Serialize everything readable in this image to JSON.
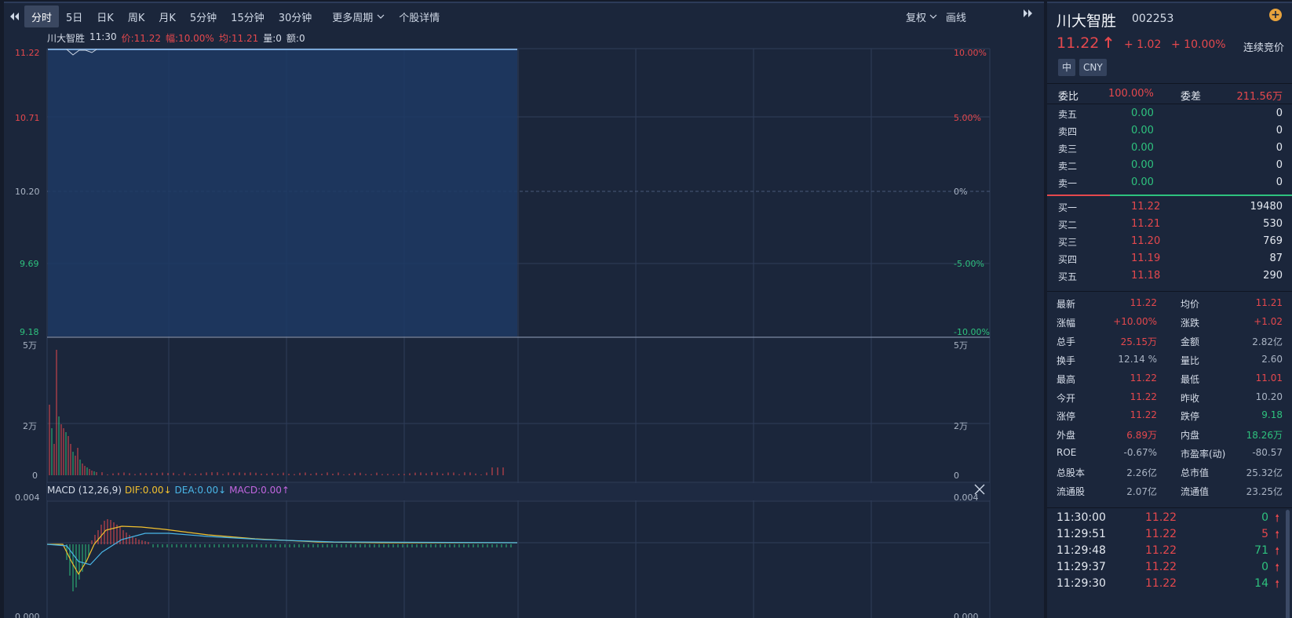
{
  "toolbar": {
    "tabs": [
      "分时",
      "5日",
      "日K",
      "周K",
      "月K",
      "5分钟",
      "15分钟",
      "30分钟",
      "更多周期",
      "个股详情"
    ],
    "right": [
      "复权",
      "画线"
    ]
  },
  "info": {
    "name": "川大智胜",
    "time": "11:30",
    "price": "价:11.22",
    "pct": "幅:10.00%",
    "avg": "均:11.21",
    "vol": "量:0",
    "amt": "额:0"
  },
  "axes": {
    "price_left": [
      "11.22",
      "10.71",
      "10.20",
      "9.69",
      "9.18"
    ],
    "price_right": [
      "10.00%",
      "5.00%",
      "0%",
      "-5.00%",
      "-10.00%"
    ],
    "vol_left": [
      "5万",
      "2万",
      "0"
    ],
    "vol_right": [
      "5万",
      "2万",
      "0"
    ],
    "macd_left": [
      "0.004",
      "0.000"
    ],
    "macd_right": [
      "0.004",
      "0.000"
    ]
  },
  "macd": {
    "label": "MACD (12,26,9)",
    "dif": "DIF:0.00↓",
    "dea": "DEA:0.00↓",
    "macd": "MACD:0.00↑"
  },
  "colors": {
    "up": "#e5484d",
    "down": "#2ec27e",
    "bg": "#1b263b",
    "dif": "#f2c12e",
    "dea": "#4ab7e8",
    "macd": "#c266e0"
  },
  "stock": {
    "name": "川大智胜",
    "code": "002253",
    "price": "11.22",
    "change": "+ 1.02",
    "pct": "+ 10.00%",
    "status": "连续竞价",
    "tags": [
      "中",
      "CNY"
    ],
    "weibi_label": "委比",
    "weibi": "100.00%",
    "weicha_label": "委差",
    "weicha": "211.56万"
  },
  "asks": [
    {
      "label": "卖五",
      "price": "0.00",
      "vol": "0"
    },
    {
      "label": "卖四",
      "price": "0.00",
      "vol": "0"
    },
    {
      "label": "卖三",
      "price": "0.00",
      "vol": "0"
    },
    {
      "label": "卖二",
      "price": "0.00",
      "vol": "0"
    },
    {
      "label": "卖一",
      "price": "0.00",
      "vol": "0"
    }
  ],
  "bids": [
    {
      "label": "买一",
      "price": "11.22",
      "vol": "19480"
    },
    {
      "label": "买二",
      "price": "11.21",
      "vol": "530"
    },
    {
      "label": "买三",
      "price": "11.20",
      "vol": "769"
    },
    {
      "label": "买四",
      "price": "11.19",
      "vol": "87"
    },
    {
      "label": "买五",
      "price": "11.18",
      "vol": "290"
    }
  ],
  "quotes": [
    {
      "l1": "最新",
      "v1": "11.22",
      "c1": "red",
      "l2": "均价",
      "v2": "11.21",
      "c2": "red"
    },
    {
      "l1": "涨幅",
      "v1": "+10.00%",
      "c1": "red",
      "l2": "涨跌",
      "v2": "+1.02",
      "c2": "red"
    },
    {
      "l1": "总手",
      "v1": "25.15万",
      "c1": "red",
      "l2": "金额",
      "v2": "2.82亿",
      "c2": "gray"
    },
    {
      "l1": "换手",
      "v1": "12.14 %",
      "c1": "gray",
      "l2": "量比",
      "v2": "2.60",
      "c2": "gray"
    },
    {
      "l1": "最高",
      "v1": "11.22",
      "c1": "red",
      "l2": "最低",
      "v2": "11.01",
      "c2": "red"
    },
    {
      "l1": "今开",
      "v1": "11.22",
      "c1": "red",
      "l2": "昨收",
      "v2": "10.20",
      "c2": "gray"
    },
    {
      "l1": "涨停",
      "v1": "11.22",
      "c1": "red",
      "l2": "跌停",
      "v2": "9.18",
      "c2": "green"
    },
    {
      "l1": "外盘",
      "v1": "6.89万",
      "c1": "red",
      "l2": "内盘",
      "v2": "18.26万",
      "c2": "green"
    },
    {
      "l1": "ROE",
      "v1": "-0.67%",
      "c1": "gray",
      "l2": "市盈率(动)",
      "v2": "-80.57",
      "c2": "gray"
    },
    {
      "l1": "总股本",
      "v1": "2.26亿",
      "c1": "gray",
      "l2": "总市值",
      "v2": "25.32亿",
      "c2": "gray"
    },
    {
      "l1": "流通股",
      "v1": "2.07亿",
      "c1": "gray",
      "l2": "流通值",
      "v2": "23.25亿",
      "c2": "gray"
    }
  ],
  "ticks": [
    {
      "time": "11:30:00",
      "price": "11.22",
      "vol": "0",
      "c": "green"
    },
    {
      "time": "11:29:51",
      "price": "11.22",
      "vol": "5",
      "c": "red"
    },
    {
      "time": "11:29:48",
      "price": "11.22",
      "vol": "71",
      "c": "green"
    },
    {
      "time": "11:29:37",
      "price": "11.22",
      "vol": "0",
      "c": "green"
    },
    {
      "time": "11:29:30",
      "price": "11.22",
      "vol": "14",
      "c": "green"
    }
  ]
}
